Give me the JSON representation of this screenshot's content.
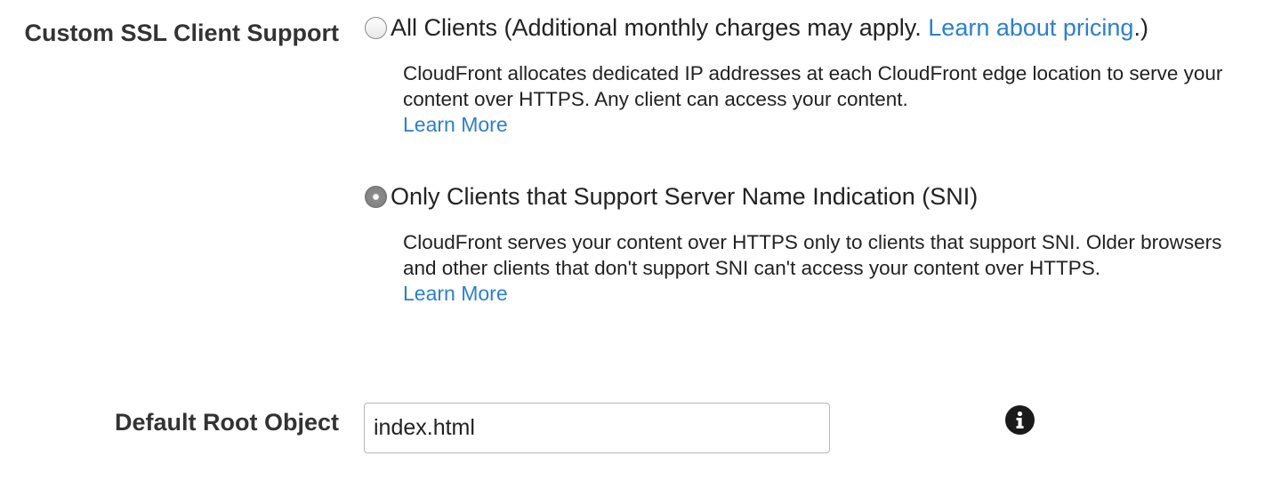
{
  "ssl_support": {
    "label": "Custom SSL Client Support",
    "options": [
      {
        "text": "All Clients (Additional monthly charges may apply. ",
        "link_text": "Learn about pricing",
        "text_after": ".)",
        "selected": false,
        "description": "CloudFront allocates dedicated IP addresses at each CloudFront edge location to serve your content over HTTPS. Any client can access your content.",
        "learn_more": "Learn More"
      },
      {
        "text": "Only Clients that Support Server Name Indication (SNI)",
        "selected": true,
        "description": "CloudFront serves your content over HTTPS only to clients that support SNI. Older browsers and other clients that don't support SNI can't access your content over HTTPS.",
        "learn_more": "Learn More"
      }
    ]
  },
  "default_root_object": {
    "label": "Default Root Object",
    "value": "index.html",
    "info_icon": "info-icon"
  },
  "colors": {
    "link": "#2a7fd4",
    "label_text": "#333333",
    "body_text": "#222222"
  }
}
